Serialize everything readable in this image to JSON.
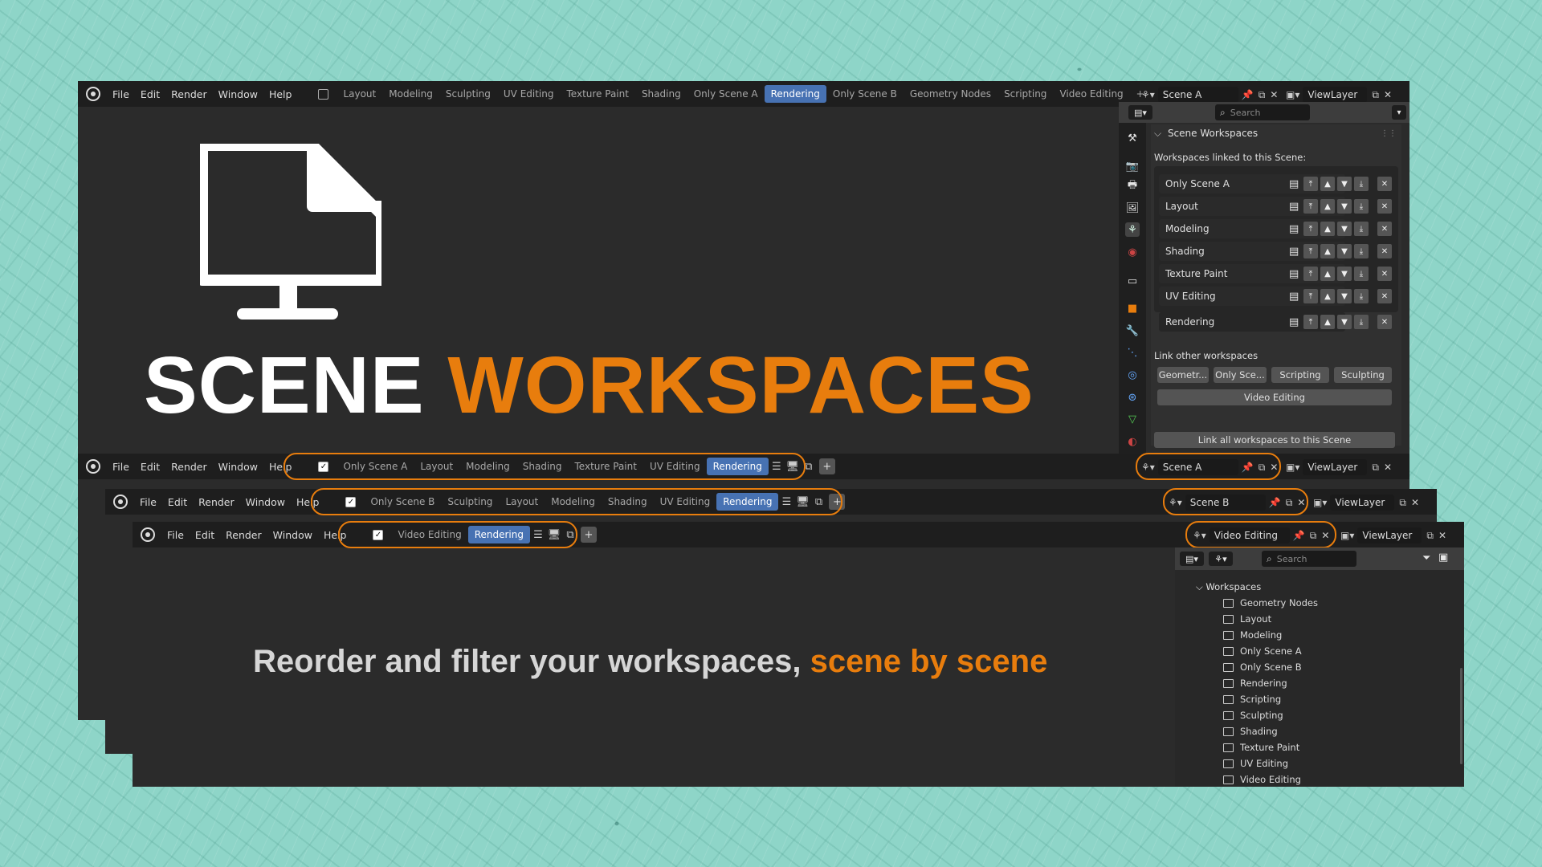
{
  "menu": [
    "File",
    "Edit",
    "Render",
    "Window",
    "Help"
  ],
  "window1": {
    "tabs": [
      "Layout",
      "Modeling",
      "Sculpting",
      "UV Editing",
      "Texture Paint",
      "Shading",
      "Only Scene A",
      "Rendering",
      "Only Scene B",
      "Geometry Nodes",
      "Scripting",
      "Video Editing"
    ],
    "active_tab": "Rendering",
    "scene": "Scene A",
    "viewlayer": "ViewLayer"
  },
  "properties": {
    "search_placeholder": "Search",
    "panel_title": "Scene Workspaces",
    "linked_label": "Workspaces linked to this Scene:",
    "linked": [
      "Only Scene A",
      "Layout",
      "Modeling",
      "Shading",
      "Texture Paint",
      "UV Editing",
      "Rendering"
    ],
    "other_label": "Link other workspaces",
    "others": [
      "Geometr...",
      "Only Sce...",
      "Scripting",
      "Sculpting"
    ],
    "video_btn": "Video Editing",
    "link_all_btn": "Link all workspaces to this Scene"
  },
  "hero": {
    "title_white": "SCENE",
    "title_orange": "WORKSPACES",
    "subtitle_white": "Reorder and filter your workspaces,",
    "subtitle_orange": "scene by scene"
  },
  "bar2": {
    "tabs": [
      "Only Scene A",
      "Layout",
      "Modeling",
      "Shading",
      "Texture Paint",
      "UV Editing",
      "Rendering"
    ],
    "scene": "Scene A",
    "viewlayer": "ViewLayer"
  },
  "bar3": {
    "tabs": [
      "Only Scene B",
      "Sculpting",
      "Layout",
      "Modeling",
      "Shading",
      "UV Editing",
      "Rendering"
    ],
    "scene": "Scene B",
    "viewlayer": "ViewLayer"
  },
  "bar4": {
    "tabs": [
      "Video Editing",
      "Rendering"
    ],
    "scene": "Video Editing",
    "viewlayer": "ViewLayer"
  },
  "outliner": {
    "search_placeholder": "Search",
    "root": "Workspaces",
    "items": [
      "Geometry Nodes",
      "Layout",
      "Modeling",
      "Only Scene A",
      "Only Scene B",
      "Rendering",
      "Scripting",
      "Sculpting",
      "Shading",
      "Texture Paint",
      "UV Editing",
      "Video Editing"
    ]
  },
  "colors": {
    "accent": "#e87d0d",
    "active_tab": "#4772b3",
    "background": "#8ed5c8"
  }
}
